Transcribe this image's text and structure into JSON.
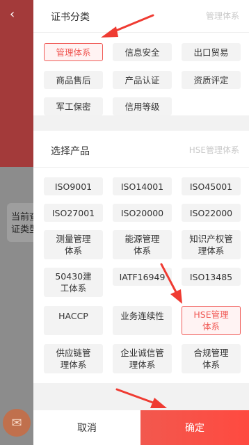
{
  "background": {
    "back_glyph": "‹",
    "card_text_line1": "当前查",
    "card_text_line2": "证类型"
  },
  "cert_section": {
    "title": "证书分类",
    "current_value": "管理体系",
    "items": [
      {
        "label": "管理体系",
        "active": true
      },
      {
        "label": "信息安全",
        "active": false
      },
      {
        "label": "出口贸易",
        "active": false
      },
      {
        "label": "商品售后",
        "active": false
      },
      {
        "label": "产品认证",
        "active": false
      },
      {
        "label": "资质评定",
        "active": false
      },
      {
        "label": "军工保密",
        "active": false
      },
      {
        "label": "信用等级",
        "active": false
      }
    ]
  },
  "product_section": {
    "title": "选择产品",
    "current_value": "HSE管理体系",
    "items": [
      {
        "label": "ISO9001"
      },
      {
        "label": "ISO14001"
      },
      {
        "label": "ISO45001"
      },
      {
        "label": "ISO27001"
      },
      {
        "label": "ISO20000"
      },
      {
        "label": "ISO22000"
      },
      {
        "label": "测量管理体系"
      },
      {
        "label": "能源管理体系"
      },
      {
        "label": "知识产权管理体系"
      },
      {
        "label": "50430建工体系"
      },
      {
        "label": "IATF16949"
      },
      {
        "label": "ISO13485"
      },
      {
        "label": "HACCP"
      },
      {
        "label": "业务连续性"
      },
      {
        "label": "HSE管理体系",
        "active": true
      },
      {
        "label": "供应链管理体系"
      },
      {
        "label": "企业诚信管理体系"
      },
      {
        "label": "合规管理体系"
      }
    ]
  },
  "footer": {
    "cancel_label": "取消",
    "confirm_label": "确定"
  },
  "colors": {
    "accent": "#f05a56",
    "arrow": "#ef3b32"
  }
}
